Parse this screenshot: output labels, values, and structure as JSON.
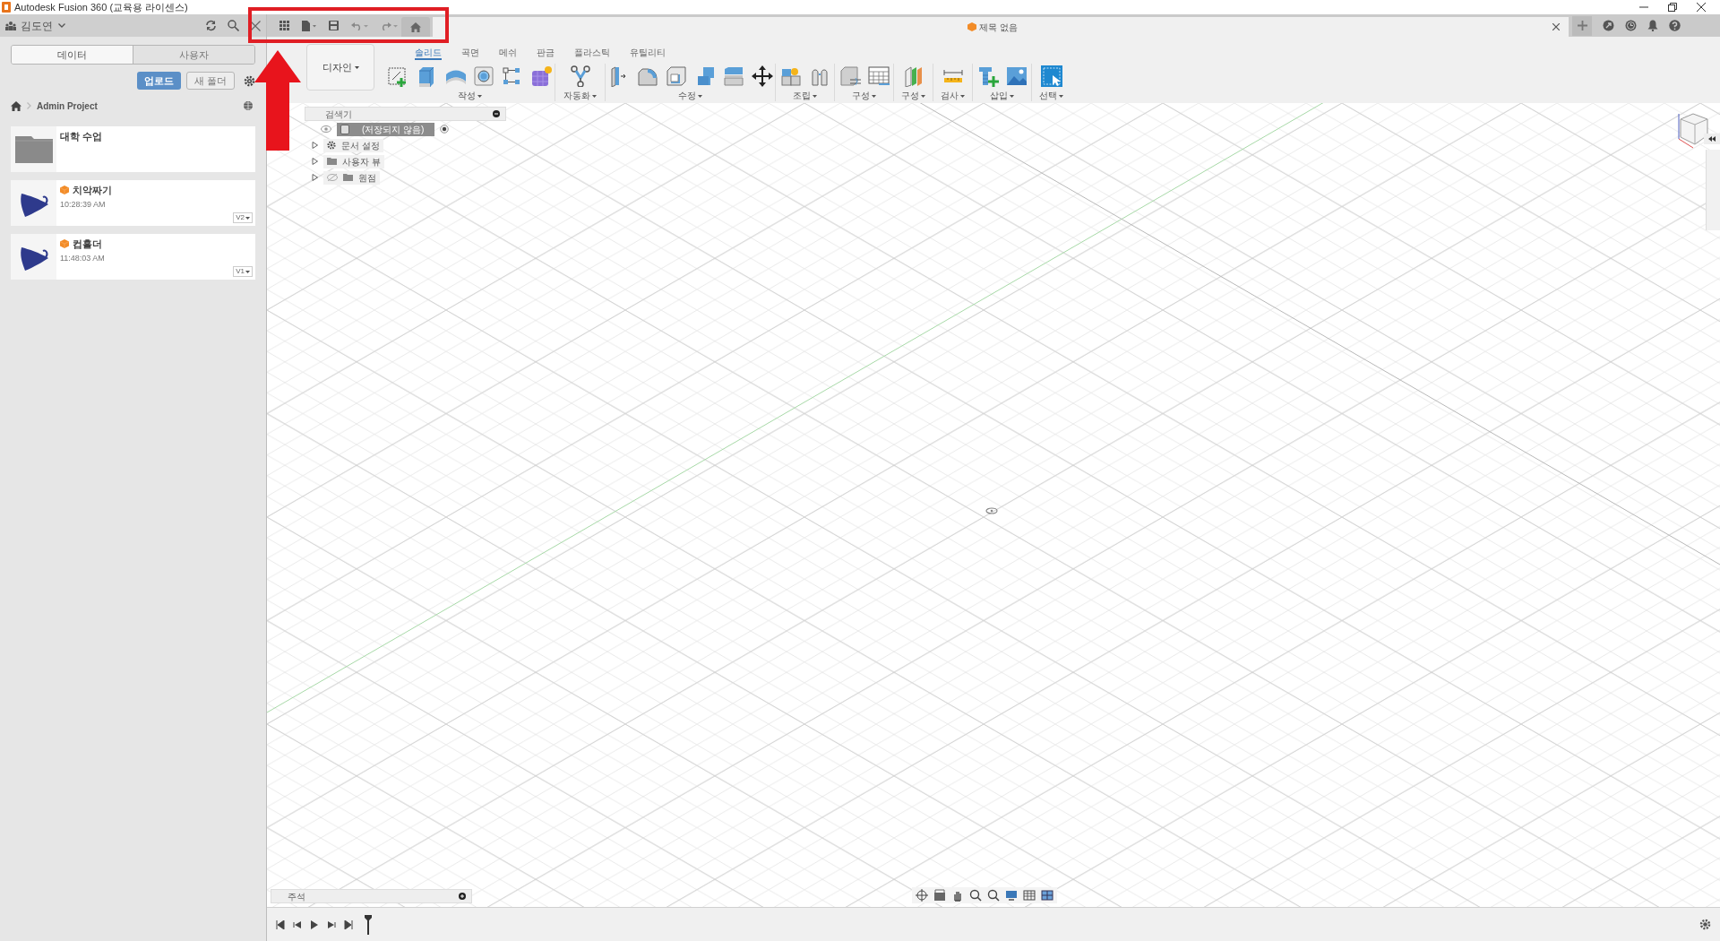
{
  "window": {
    "title": "Autodesk Fusion 360 (교육용 라이센스)"
  },
  "data_panel": {
    "user": "김도연",
    "tabs": [
      {
        "label": "데이터",
        "selected": true
      },
      {
        "label": "사용자",
        "selected": false
      }
    ],
    "upload_button": "업로드",
    "new_folder_button": "새 폴더",
    "breadcrumb": "Admin Project",
    "items": [
      {
        "kind": "folder",
        "name": "대학 수업"
      },
      {
        "kind": "design",
        "name": "치악짜기",
        "time": "10:28:39 AM",
        "version": "V2"
      },
      {
        "kind": "design",
        "name": "컵홀더",
        "time": "11:48:03 AM",
        "version": "V1"
      }
    ]
  },
  "document_tab": {
    "title": "제목 없음"
  },
  "toolbar": {
    "workspace": "디자인",
    "tabs": [
      {
        "label": "솔리드",
        "selected": true
      },
      {
        "label": "곡면",
        "selected": false
      },
      {
        "label": "메쉬",
        "selected": false
      },
      {
        "label": "판금",
        "selected": false
      },
      {
        "label": "플라스틱",
        "selected": false
      },
      {
        "label": "유틸리티",
        "selected": false
      }
    ],
    "groups": [
      {
        "label": "작성"
      },
      {
        "label": "자동화"
      },
      {
        "label": "수정"
      },
      {
        "label": "조립"
      },
      {
        "label": "구성"
      },
      {
        "label": "구성"
      },
      {
        "label": "검사"
      },
      {
        "label": "삽입"
      },
      {
        "label": "선택"
      }
    ]
  },
  "browser": {
    "title": "검색기",
    "items": [
      {
        "kind": "root",
        "label": "(저장되지 않음)",
        "visible": true,
        "active": true
      },
      {
        "kind": "settings",
        "label": "문서 설정",
        "expanded": false
      },
      {
        "kind": "folder",
        "label": "사용자 뷰",
        "expanded": false
      },
      {
        "kind": "folder",
        "label": "원점",
        "expanded": false,
        "visible": false
      }
    ]
  },
  "comments_panel": {
    "title": "주석"
  }
}
